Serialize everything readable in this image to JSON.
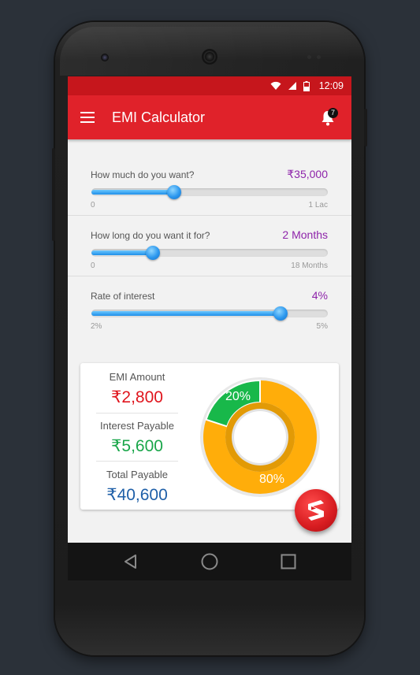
{
  "status_bar": {
    "time": "12:09",
    "icons": [
      "wifi-icon",
      "signal-icon",
      "battery-icon"
    ]
  },
  "app_bar": {
    "title": "EMI Calculator",
    "menu_icon": "hamburger-menu-icon",
    "notification_icon": "bell-icon",
    "notification_count": "7"
  },
  "sliders": [
    {
      "question": "How much do you want?",
      "value": "₹35,000",
      "min_label": "0",
      "max_label": "1 Lac",
      "position": 0.35
    },
    {
      "question": "How long do you want it for?",
      "value": "2 Months",
      "min_label": "0",
      "max_label": "18 Months",
      "position": 0.26
    },
    {
      "question": "Rate of interest",
      "value": "4%",
      "min_label": "2%",
      "max_label": "5%",
      "position": 0.8
    }
  ],
  "results": {
    "emi": {
      "label": "EMI Amount",
      "value": "₹2,800",
      "color": "#e0151d"
    },
    "interest": {
      "label": "Interest Payable",
      "value": "₹5,600",
      "color": "#1aa64a"
    },
    "total": {
      "label": "Total Payable",
      "value": "₹40,600",
      "color": "#1e5fa8"
    }
  },
  "breakdown": {
    "interest_percent": 20,
    "principal_percent": 80,
    "interest_label": "20%",
    "principal_label": "80%",
    "interest_color": "#18b84a",
    "principal_color": "#ffad0a"
  },
  "fab": {
    "icon": "brand-logo-icon"
  },
  "nav_bar": {
    "icons": [
      "back-icon",
      "home-icon",
      "recents-icon"
    ]
  },
  "colors": {
    "primary": "#e0222a",
    "status_bar": "#c6161c",
    "accent_value": "#8e24aa",
    "slider": "#2b97ee"
  }
}
